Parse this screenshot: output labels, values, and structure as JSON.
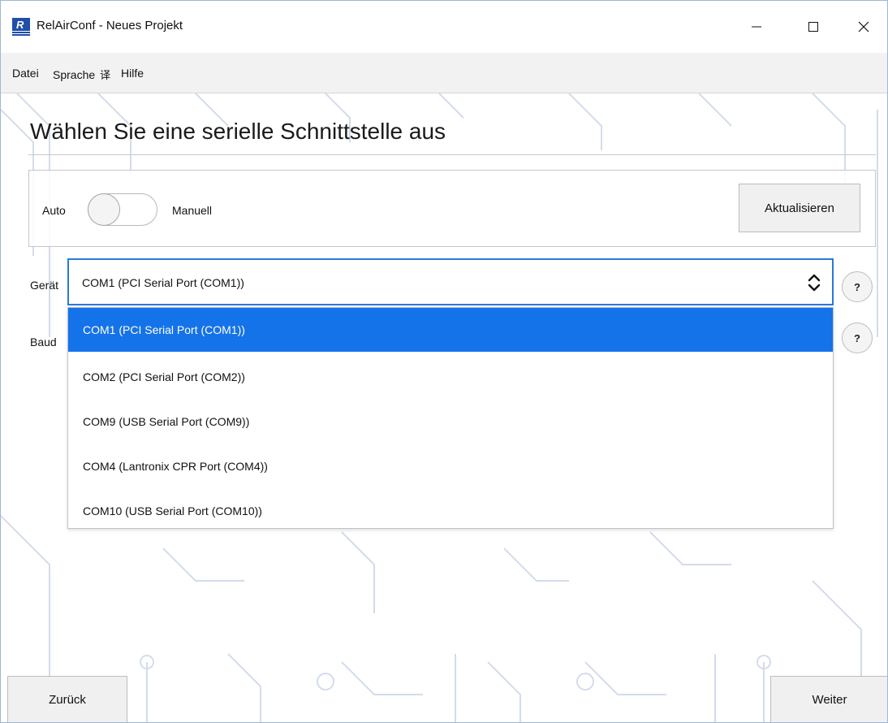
{
  "window": {
    "title": "RelAirConf - Neues Projekt",
    "app_icon": "relairconf-logo-icon",
    "controls": [
      "minimize-icon",
      "maximize-icon",
      "close-icon"
    ]
  },
  "menu": {
    "items": [
      {
        "label": "Datei"
      },
      {
        "label": "Sprache",
        "icon": "language-icon",
        "icon_glyph": "译"
      },
      {
        "label": "Hilfe"
      }
    ]
  },
  "page": {
    "heading": "Wählen Sie eine serielle Schnittstelle aus"
  },
  "mode": {
    "auto_label": "Auto",
    "manual_label": "Manuell",
    "toggle_state": "auto",
    "refresh_label": "Aktualisieren"
  },
  "device": {
    "label": "Gerät",
    "selected": "COM1 (PCI Serial Port (COM1))",
    "options": [
      "COM1 (PCI Serial Port (COM1))",
      "COM2 (PCI Serial Port (COM2))",
      "COM9 (USB Serial Port (COM9))",
      "COM4 (Lantronix CPR Port (COM4))",
      "COM10 (USB Serial Port (COM10))"
    ],
    "highlighted_index": 0,
    "help_label": "?"
  },
  "baud": {
    "label": "Baud",
    "help_label": "?"
  },
  "footer": {
    "back_label": "Zurück",
    "next_label": "Weiter"
  },
  "colors": {
    "accent": "#1573ea",
    "focus_border": "#2b78d8",
    "pattern": "#cfd9ea"
  }
}
